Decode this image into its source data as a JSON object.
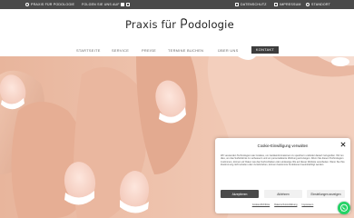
{
  "topbar": {
    "left": [
      {
        "icon": "map-pin-icon",
        "label": "PRAXIS FÜR PODOLOGIE"
      },
      {
        "icon": "",
        "label": "FOLGEN SIE UNS AUF"
      }
    ],
    "social": [
      "facebook-icon",
      "instagram-icon"
    ],
    "right": [
      {
        "icon": "lock-icon",
        "label": "DATENSCHUTZ"
      },
      {
        "icon": "document-icon",
        "label": "IMPRESSUM"
      },
      {
        "icon": "location-icon",
        "label": "STANDORT"
      }
    ]
  },
  "header": {
    "logo_prefix": "Praxis für ",
    "logo_suffix": "odologie"
  },
  "nav": {
    "items": [
      "STARTSEITE",
      "SERVICE",
      "PREISE",
      "TERMINE BUCHEN",
      "ÜBER UNS"
    ],
    "active": "KONTAKT"
  },
  "cookie": {
    "title": "Cookie-Einwilligung verwalten",
    "body": "Wir verwenden Technologien wie Cookies, um Geräteinformationen zu speichern und/oder darauf zuzugreifen. Wir tun dies, um das Surferlebnis zu verbessern und um personalisierte Werbung anzuzeigen. Wenn Sie diesen Technologien zustimmen, können wir Daten wie das Surfverhalten oder eindeutige IDs auf dieser Website verarbeiten. Wenn Sie Ihre Zustimmung nicht erteilen oder zurückziehen, können bestimmte Funktionen beeinträchtigt werden.",
    "accept": "Akzeptieren",
    "reject": "Ablehnen",
    "preferences": "Einstellungen anzeigen",
    "links": [
      "Cookie-Richtlinie",
      "Datenschutzerklärung",
      "Impressum"
    ]
  },
  "colors": {
    "topbar": "#4a4a4a",
    "nav_active": "#3d3d3d",
    "whatsapp": "#25d366"
  }
}
